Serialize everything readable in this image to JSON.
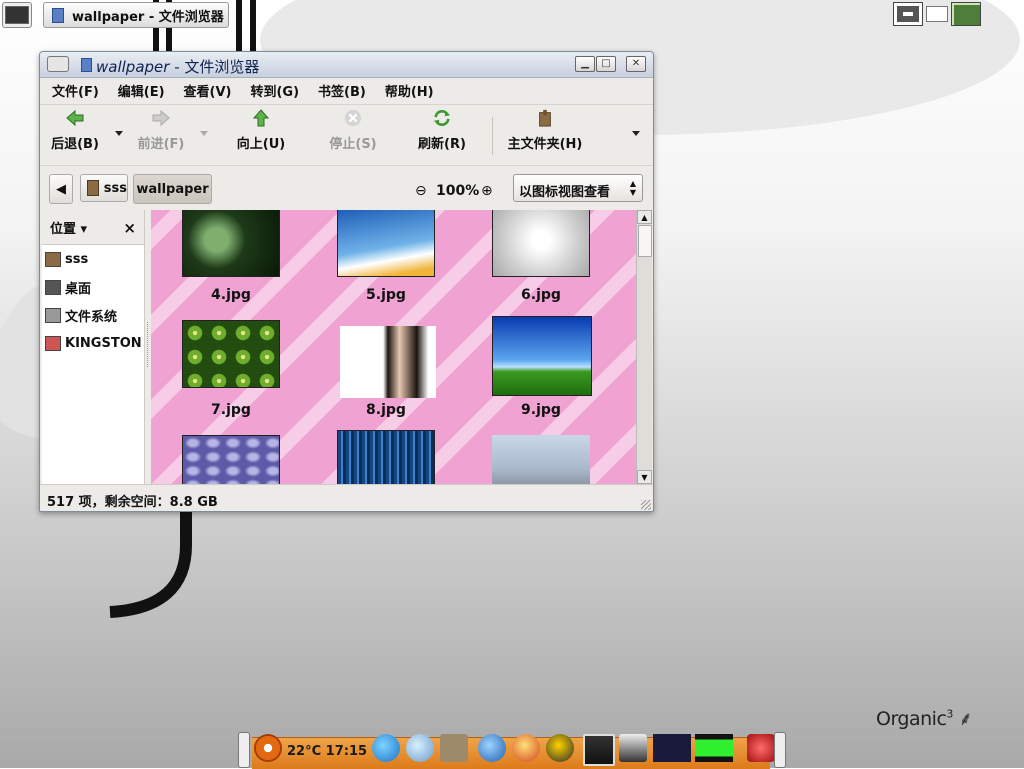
{
  "taskbar": {
    "task_label": "wallpaper - 文件浏览器"
  },
  "window": {
    "title_app": "wallpaper",
    "title_rest": " - 文件浏览器"
  },
  "menubar": [
    "文件(F)",
    "编辑(E)",
    "查看(V)",
    "转到(G)",
    "书签(B)",
    "帮助(H)"
  ],
  "toolbar": {
    "back": "后退(B)",
    "forward": "前进(F)",
    "up": "向上(U)",
    "stop": "停止(S)",
    "refresh": "刷新(R)",
    "home": "主文件夹(H)"
  },
  "location": {
    "crumbs": [
      "sss",
      "wallpaper"
    ],
    "zoom": "100%",
    "view_mode": "以图标视图查看"
  },
  "sidepane": {
    "header": "位置",
    "close": "×",
    "places": [
      "sss",
      "桌面",
      "文件系统",
      "KINGSTON"
    ]
  },
  "files": [
    "4.jpg",
    "5.jpg",
    "6.jpg",
    "7.jpg",
    "8.jpg",
    "9.jpg"
  ],
  "status": "517 项，剩余空间：8.8 GB",
  "dock": {
    "weather": "22°C 17:15"
  },
  "brand": {
    "name": "Organic",
    "sup": "3"
  },
  "colors": {
    "iconview_bg": "#f0a3d2",
    "dock": "#e8902c",
    "titlebar": "#c8d0de"
  }
}
